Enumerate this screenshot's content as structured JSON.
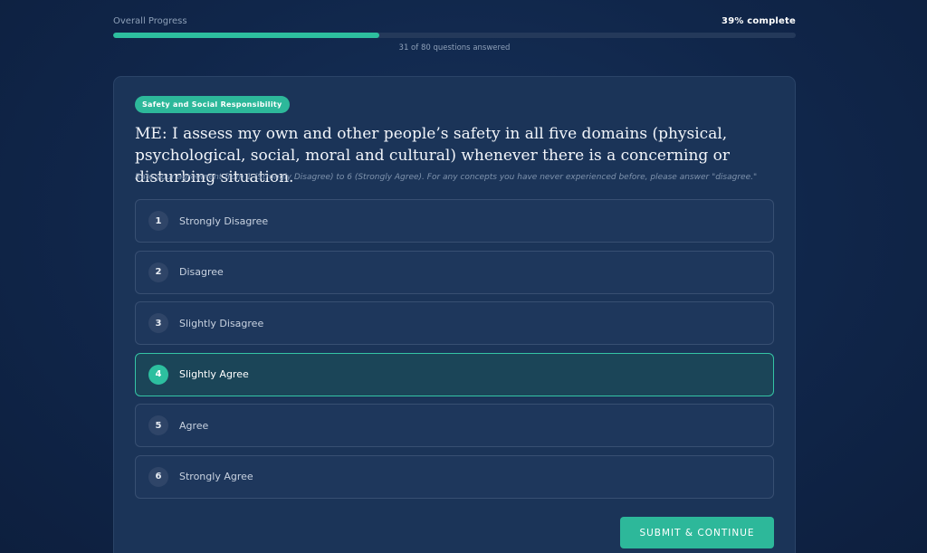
{
  "progress": {
    "label": "Overall Progress",
    "percent_text": "39% complete",
    "fraction": 0.39,
    "answered_text": "31 of 80 questions answered"
  },
  "question": {
    "category": "Safety and Social Responsibility",
    "text": "ME: I assess my own and other people’s safety in all five domains (physical, psychological, social, moral and cultural) whenever there is a concerning or disturbing situation.",
    "instructions": "Rate your agreement from 1 (Strongly Disagree) to 6 (Strongly Agree). For any concepts you have never experienced before, please answer \"disagree.\""
  },
  "options": [
    {
      "number": "1",
      "label": "Strongly Disagree"
    },
    {
      "number": "2",
      "label": "Disagree"
    },
    {
      "number": "3",
      "label": "Slightly Disagree"
    },
    {
      "number": "4",
      "label": "Slightly Agree"
    },
    {
      "number": "5",
      "label": "Agree"
    },
    {
      "number": "6",
      "label": "Strongly Agree"
    }
  ],
  "selected_option": "4",
  "submit_label": "SUBMIT & CONTINUE",
  "colors": {
    "accent": "#2dbf9f",
    "background": "#10264a",
    "card": "#1b3458"
  }
}
